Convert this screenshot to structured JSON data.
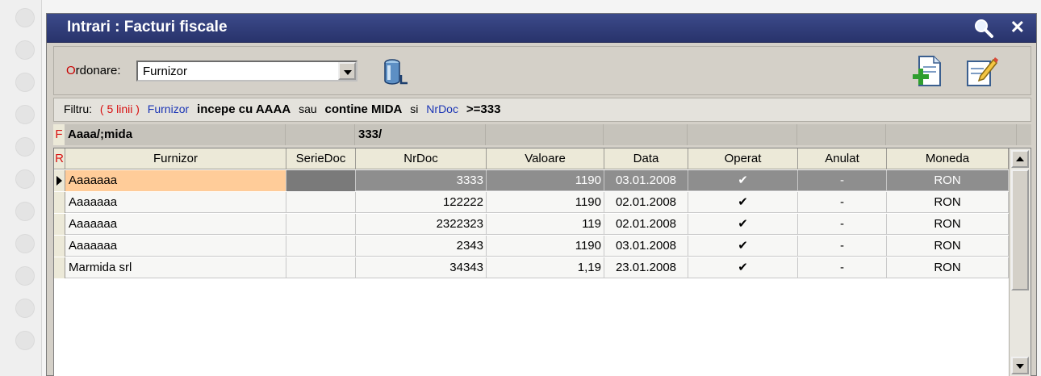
{
  "window": {
    "title": "Intrari : Facturi fiscale"
  },
  "toolbar": {
    "order_label_hotkey": "O",
    "order_label_rest": "rdonare:",
    "order_value": "Furnizor"
  },
  "filter": {
    "prefix": "Filtru:",
    "count": "( 5 linii )",
    "field1": "Furnizor",
    "cond1": "incepe cu AAAA",
    "join1": "sau",
    "cond2": "contine MIDA",
    "join2": "si",
    "field2": "NrDoc",
    "cond3": ">=333"
  },
  "filter_row": {
    "marker": "F",
    "furnizor": "Aaaa/;mida",
    "nrdoc": "333/"
  },
  "grid": {
    "marker": "R",
    "columns": [
      "Furnizor",
      "SerieDoc",
      "NrDoc",
      "Valoare",
      "Data",
      "Operat",
      "Anulat",
      "Moneda"
    ],
    "rows": [
      [
        "Aaaaaaa",
        "",
        "3333",
        "1190",
        "03.01.2008",
        "✔",
        "-",
        "RON"
      ],
      [
        "Aaaaaaa",
        "",
        "122222",
        "1190",
        "02.01.2008",
        "✔",
        "-",
        "RON"
      ],
      [
        "Aaaaaaa",
        "",
        "2322323",
        "119",
        "02.01.2008",
        "✔",
        "-",
        "RON"
      ],
      [
        "Aaaaaaa",
        "",
        "2343",
        "1190",
        "03.01.2008",
        "✔",
        "-",
        "RON"
      ],
      [
        "Marmida srl",
        "",
        "34343",
        "1,19",
        "23.01.2008",
        "✔",
        "-",
        "RON"
      ]
    ],
    "selected_row": 0
  },
  "colors": {
    "title_bg": "#28336b",
    "selected_row": "#8e8e8e",
    "selected_cell": "#ffcc99",
    "hotkey": "#d81010",
    "field": "#1b35b5"
  }
}
